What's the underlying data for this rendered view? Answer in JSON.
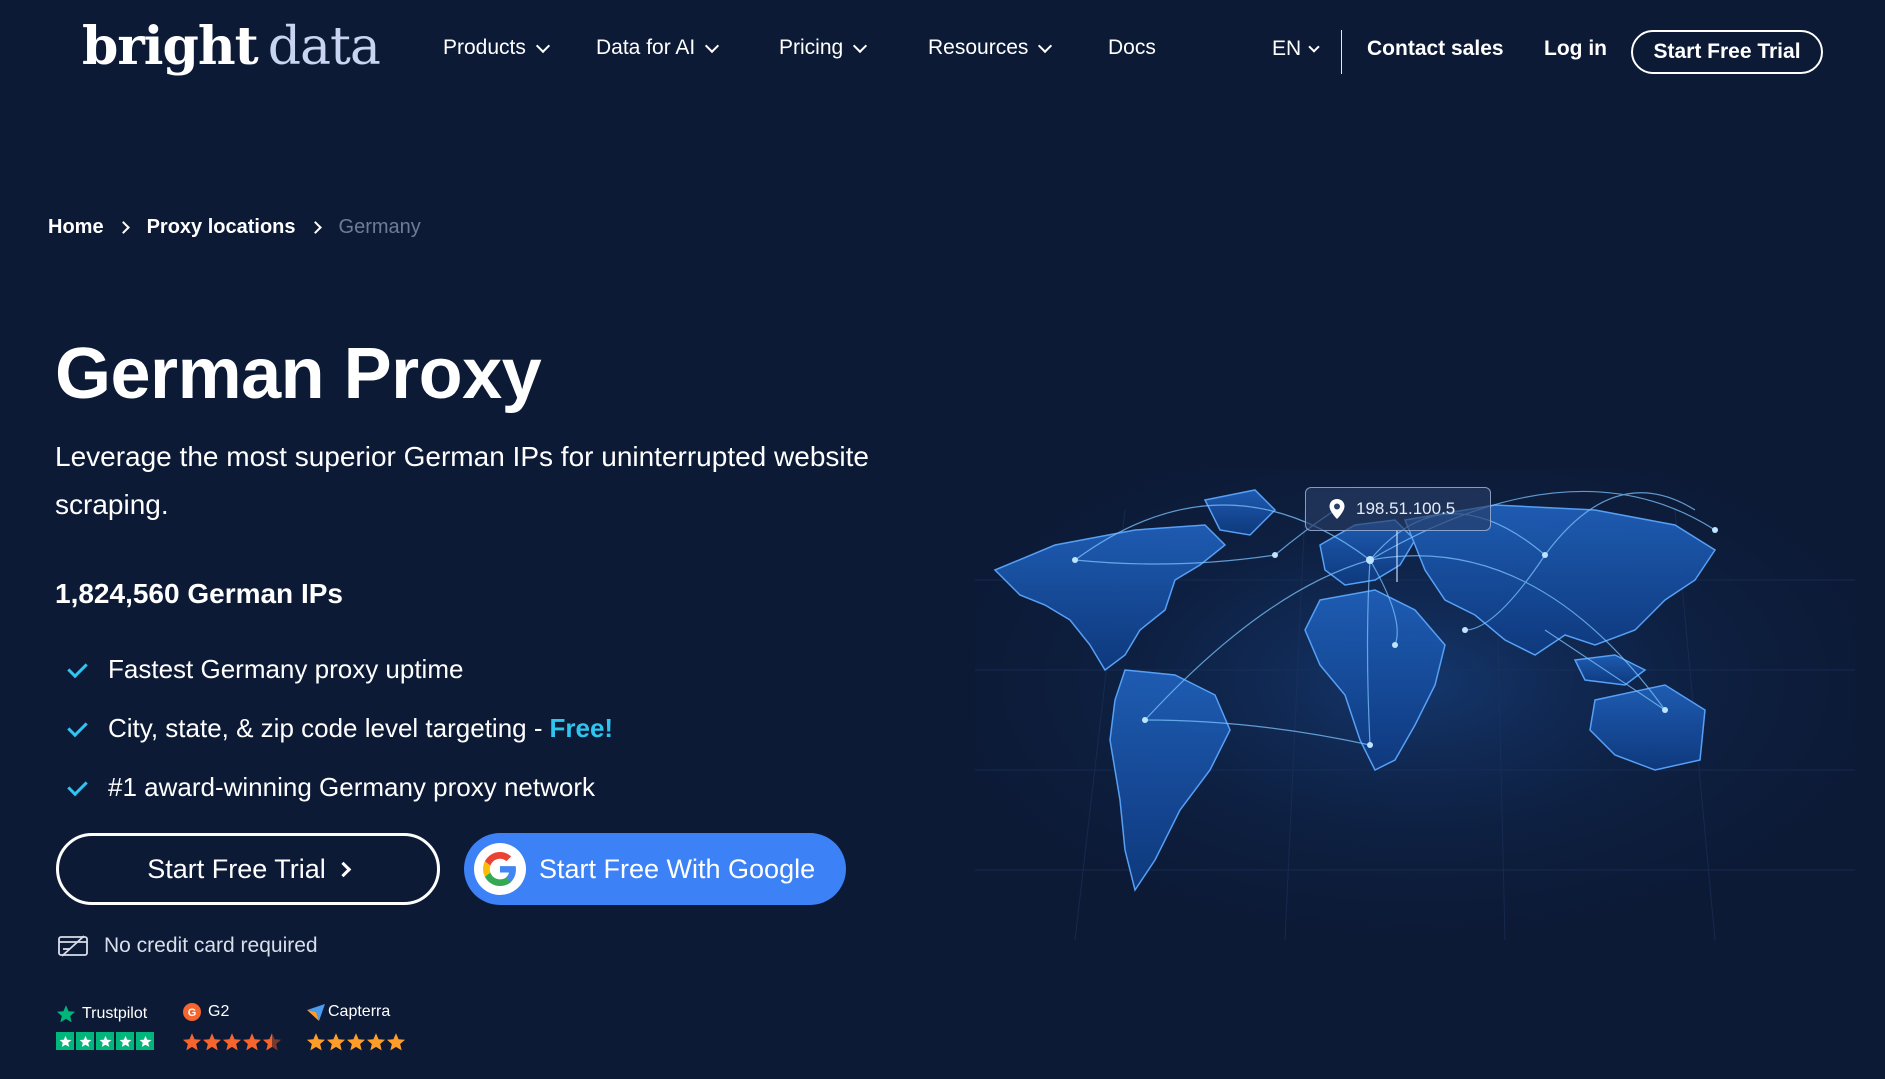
{
  "header": {
    "logo_word1": "bright",
    "logo_word2": "data",
    "nav": [
      {
        "label": "Products"
      },
      {
        "label": "Data for AI"
      },
      {
        "label": "Pricing"
      },
      {
        "label": "Resources"
      },
      {
        "label": "Docs"
      }
    ],
    "lang": "EN",
    "contact": "Contact sales",
    "login": "Log in",
    "cta": "Start Free Trial"
  },
  "breadcrumb": {
    "home": "Home",
    "locations": "Proxy locations",
    "current": "Germany"
  },
  "hero": {
    "title": "German Proxy",
    "subtitle": "Leverage the most superior German IPs for uninterrupted website scraping.",
    "ip_count": "1,824,560 German IPs",
    "features": [
      {
        "text": "Fastest Germany proxy uptime",
        "highlight": ""
      },
      {
        "text": "City, state, & zip code level targeting -",
        "highlight": "Free!"
      },
      {
        "text": "#1 award-winning Germany proxy network",
        "highlight": ""
      }
    ],
    "btn_trial": "Start Free Trial",
    "btn_google": "Start Free With Google",
    "no_cc": "No credit card required"
  },
  "ratings": {
    "trustpilot": "Trustpilot",
    "g2": "G2",
    "capterra": "Capterra"
  },
  "map": {
    "ip_label": "198.51.100.5"
  },
  "colors": {
    "background": "#0c1a36",
    "accent": "#2ec5f1",
    "google_button": "#3c82f6",
    "trustpilot_green": "#00b67a",
    "rating_orange": "#f5652d",
    "capterra_yellow": "#ff9d28"
  }
}
